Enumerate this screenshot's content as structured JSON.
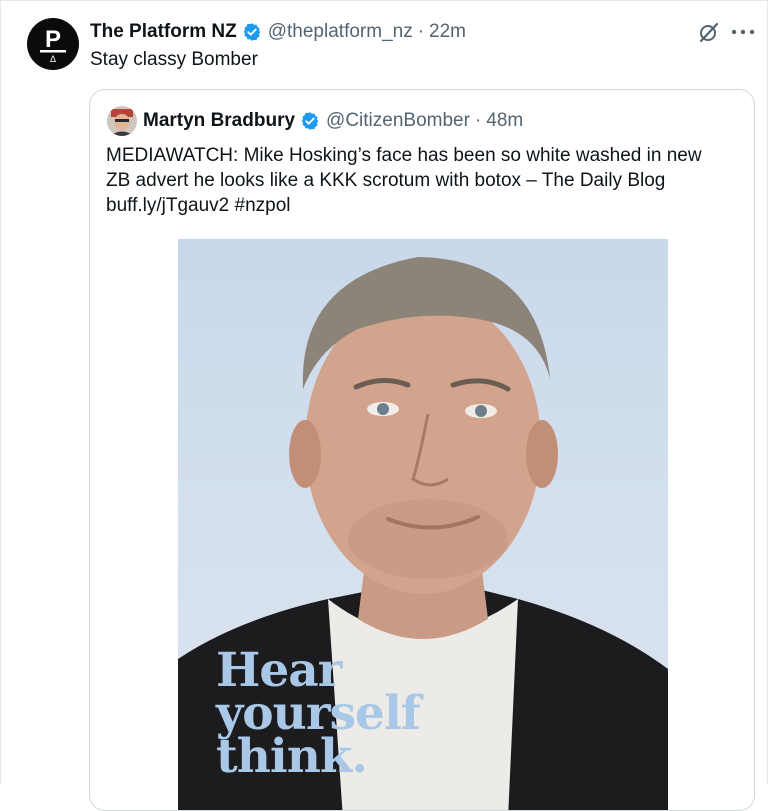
{
  "tweet": {
    "author_name": "The Platform NZ",
    "author_handle": "@theplatform_nz",
    "time": "22m",
    "separator": "·",
    "text": "Stay classy Bomber",
    "avatar_letter": "P",
    "avatar_sub": "Δ"
  },
  "quoted": {
    "author_name": "Martyn Bradbury",
    "author_handle": "@CitizenBomber",
    "time": "48m",
    "separator": "·",
    "text_lines": [
      "MEDIAWATCH: Mike Hosking’s face has been so white washed in new",
      "ZB advert he looks like a KKK scrotum with botox – The Daily Blog",
      "buff.ly/jTgauv2 #nzpol"
    ],
    "media_overlay_lines": [
      "Hear",
      "yourself",
      "think."
    ]
  },
  "icons": {
    "verified": "verified-badge-icon",
    "grok": "grok-icon",
    "more": "more-icon"
  },
  "colors": {
    "verified_blue": "#1d9bf0",
    "secondary_text": "#536471",
    "overlay_text": "#a9c7e6"
  }
}
